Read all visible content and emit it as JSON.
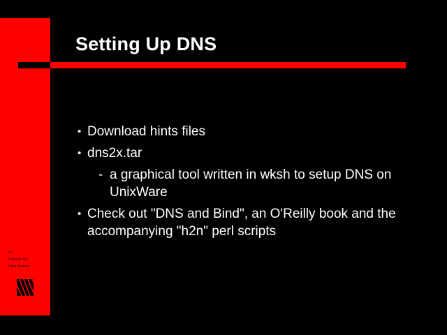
{
  "slide": {
    "title": "Setting Up DNS",
    "colors": {
      "background": "#000000",
      "accent": "#ff0000",
      "text": "#ffffff"
    },
    "bullets": [
      {
        "mark": "•",
        "text": "Download hints files"
      },
      {
        "mark": "•",
        "text": "dns2x.tar"
      }
    ],
    "sub_bullet": {
      "mark": "-",
      "text": "a graphical tool written in wksh to setup DNS on UnixWare"
    },
    "last_bullet": {
      "mark": "•",
      "text": "Check out \"DNS and Bind\", an O'Reilly book and the accompanying \"h2n\" perl scripts"
    },
    "footer": {
      "page_number": "40",
      "copyright": "© Novell, Inc.",
      "track_number": "Track Number"
    },
    "logo_icon": "novell-logo-icon"
  }
}
